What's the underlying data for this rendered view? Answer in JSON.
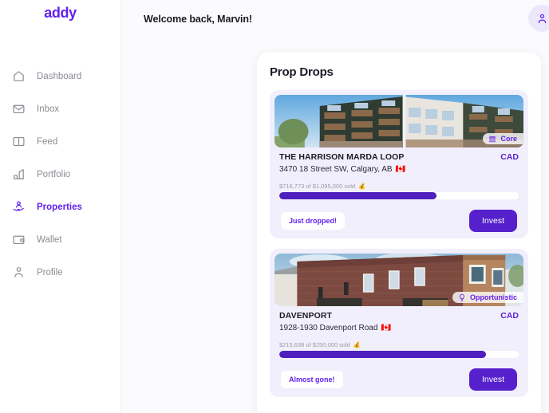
{
  "brand": {
    "logo": "addy",
    "accent": "#6320ee"
  },
  "sidebar": {
    "items": [
      {
        "label": "Dashboard",
        "icon": "home-icon",
        "active": false
      },
      {
        "label": "Inbox",
        "icon": "envelope-icon",
        "active": false
      },
      {
        "label": "Feed",
        "icon": "book-icon",
        "active": false
      },
      {
        "label": "Portfolio",
        "icon": "bar-chart-icon",
        "active": false
      },
      {
        "label": "Properties",
        "icon": "hand-holding-person-icon",
        "active": true
      },
      {
        "label": "Wallet",
        "icon": "wallet-icon",
        "active": false
      },
      {
        "label": "Profile",
        "icon": "user-icon",
        "active": false
      }
    ]
  },
  "header": {
    "greeting": "Welcome back, Marvin!",
    "avatar_icon": "user-avatar-icon"
  },
  "panel": {
    "title": "Prop Drops",
    "cards": [
      {
        "name": "THE HARRISON MARDA LOOP",
        "address": "3470 18 Street SW, Calgary, AB",
        "flag": "🇨🇦",
        "currency": "CAD",
        "tag": "Core",
        "tag_icon": "building-columns-icon",
        "sold_text": "$716,773 of $1,095,000 sold",
        "sold_icon": "💰",
        "sold_amount": 716773,
        "total_amount": 1095000,
        "progress_percent": 65.5,
        "status_pill": "Just dropped!",
        "cta": "Invest",
        "photo": "modern-apartment-building"
      },
      {
        "name": "DAVENPORT",
        "address": "1928-1930 Davenport Road",
        "flag": "🇨🇦",
        "currency": "CAD",
        "tag": "Opportunistic",
        "tag_icon": "lightbulb-icon",
        "sold_text": "$215,638 of $250,000 sold",
        "sold_icon": "💰",
        "sold_amount": 215638,
        "total_amount": 250000,
        "progress_percent": 86.3,
        "status_pill": "Almost gone!",
        "cta": "Invest",
        "photo": "brick-building-shingled-roof"
      }
    ]
  }
}
